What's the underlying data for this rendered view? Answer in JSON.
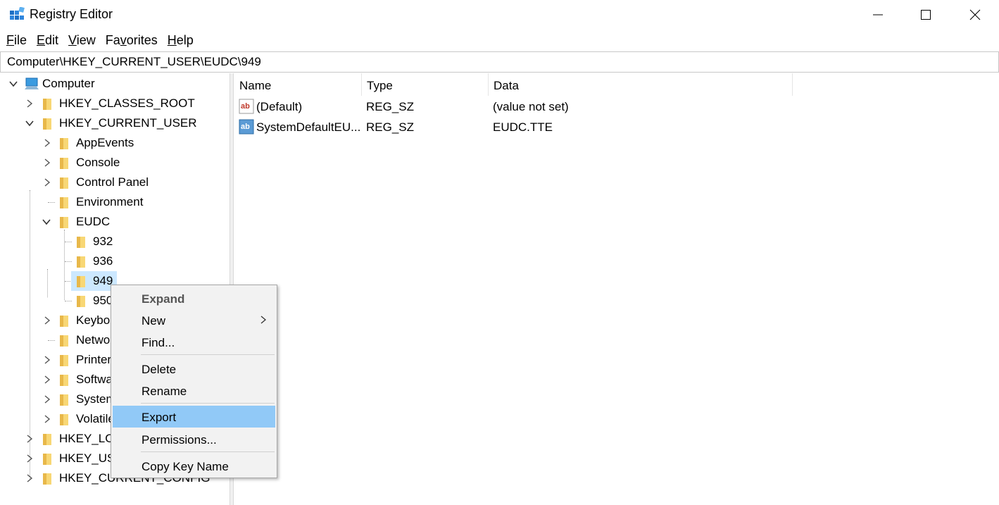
{
  "window": {
    "title": "Registry Editor",
    "minimize_icon": "minimize-icon",
    "maximize_icon": "maximize-icon",
    "close_icon": "close-icon"
  },
  "menu": {
    "file": {
      "accel": "F",
      "rest": "ile"
    },
    "edit": {
      "accel": "E",
      "rest": "dit"
    },
    "view": {
      "accel": "V",
      "rest": "iew"
    },
    "favorites": {
      "pre": "Fa",
      "accel": "v",
      "rest": "orites"
    },
    "help": {
      "accel": "H",
      "rest": "elp"
    }
  },
  "address": "Computer\\HKEY_CURRENT_USER\\EUDC\\949",
  "tree": {
    "computer": "Computer",
    "hkcr": "HKEY_CLASSES_ROOT",
    "hkcu": "HKEY_CURRENT_USER",
    "appevents": "AppEvents",
    "console": "Console",
    "control_panel": "Control Panel",
    "environment": "Environment",
    "eudc": "EUDC",
    "k932": "932",
    "k936": "936",
    "k949": "949",
    "k950": "950",
    "keyboard": "Keyboard Layout",
    "network": "Network",
    "printers": "Printers",
    "software": "Software",
    "system": "System",
    "volatile": "Volatile Environment",
    "hklm": "HKEY_LOCAL_MACHINE",
    "hku": "HKEY_USERS",
    "hkcc": "HKEY_CURRENT_CONFIG"
  },
  "list": {
    "headers": {
      "name": "Name",
      "type": "Type",
      "data": "Data"
    },
    "rows": [
      {
        "name": "(Default)",
        "type": "REG_SZ",
        "data": "(value not set)"
      },
      {
        "name": "SystemDefaultEU...",
        "type": "REG_SZ",
        "data": "EUDC.TTE"
      }
    ]
  },
  "context_menu": {
    "expand": "Expand",
    "new": "New",
    "find": "Find...",
    "delete": "Delete",
    "rename": "Rename",
    "export": "Export",
    "permissions": "Permissions...",
    "copy_key_name": "Copy Key Name"
  },
  "colors": {
    "selection": "#cce8ff",
    "menu_highlight": "#91c9f7",
    "folder": "#f8d775"
  }
}
